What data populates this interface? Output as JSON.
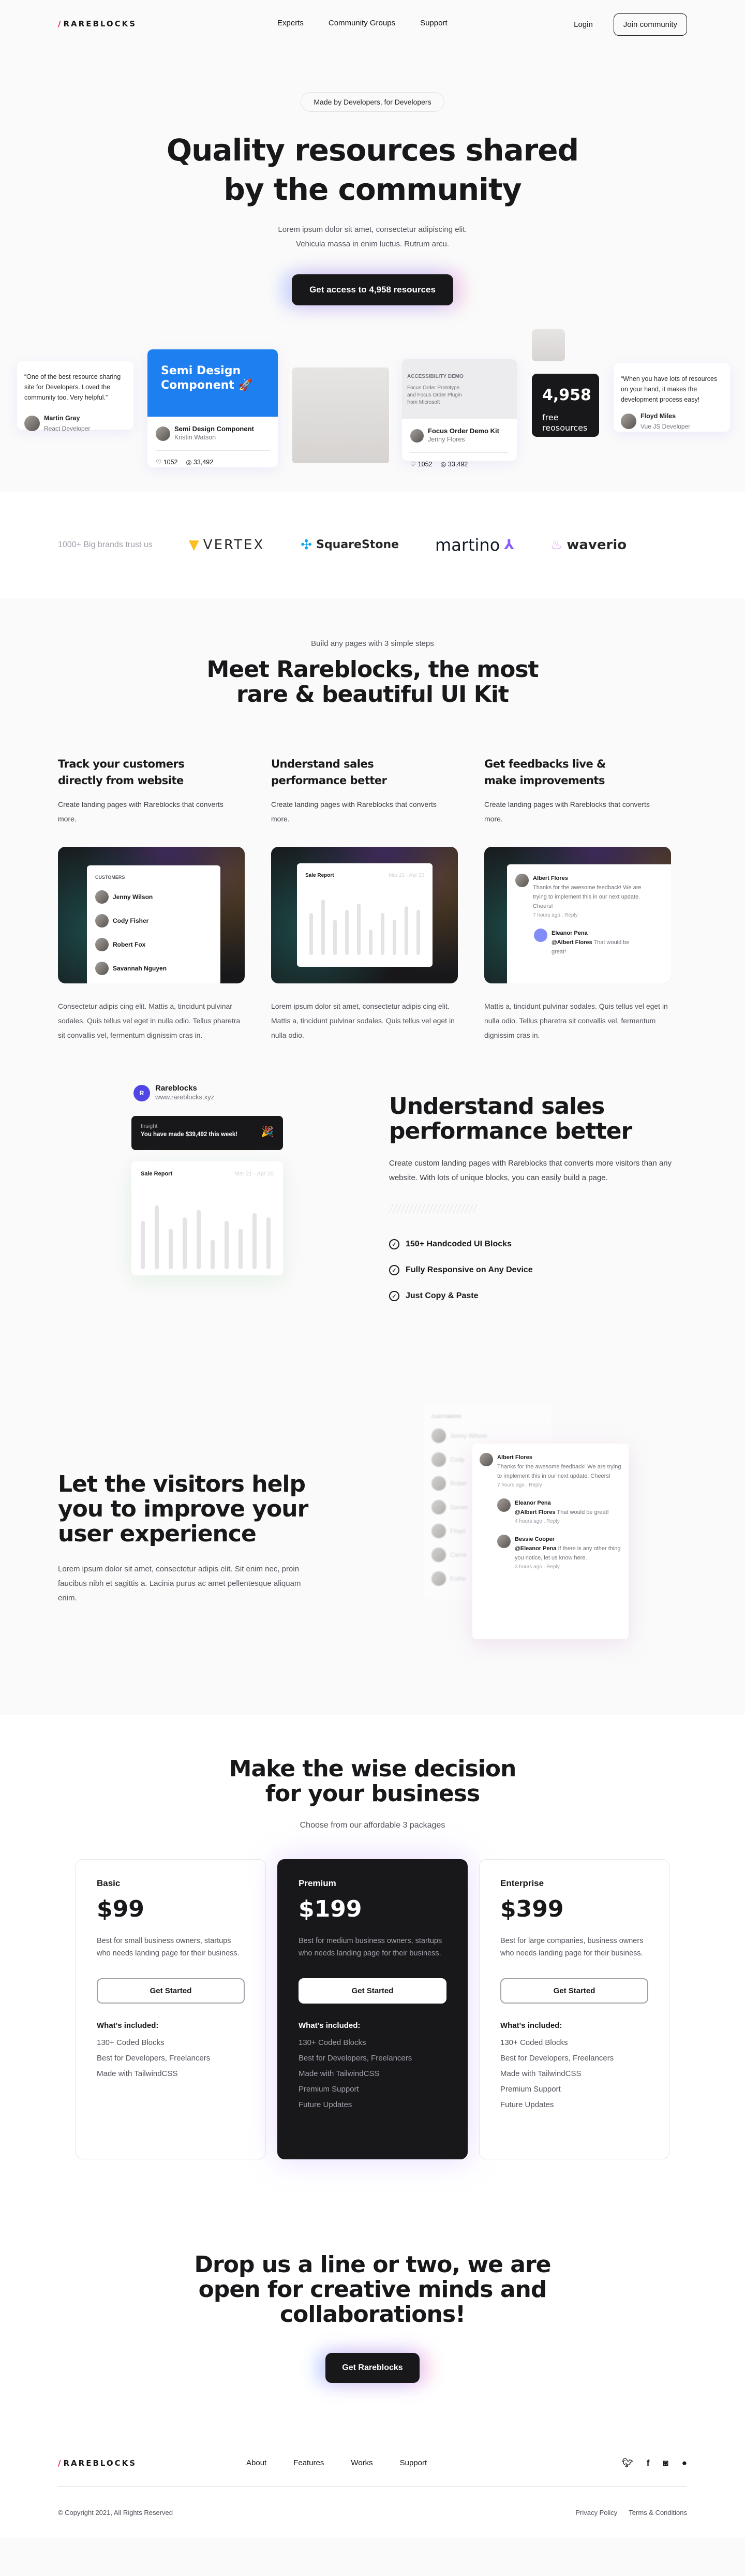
{
  "header": {
    "logo_slash": "/",
    "logo_text": "RAREBLOCKS",
    "nav": [
      "Experts",
      "Community Groups",
      "Support"
    ],
    "login": "Login",
    "join": "Join community"
  },
  "hero": {
    "pill": "Made by Developers, for Developers",
    "title_line1": "Quality resources shared",
    "title_line2": "by the community",
    "desc_line1": "Lorem ipsum dolor sit amet, consectetur adipiscing elit.",
    "desc_line2": "Vehicula massa in enim luctus. Rutrum arcu.",
    "cta": "Get access to 4,958 resources"
  },
  "showcase": {
    "testimonial1": {
      "quote": "“One of the best resource sharing site for Developers. Loved the community too. Very helpful.”",
      "name": "Martin Gray",
      "role": "React Developer"
    },
    "resource1": {
      "banner": "Semi Design Component 🚀",
      "title": "Semi Design Component",
      "author": "Kristin Watson",
      "likes": "1052",
      "views": "33,492"
    },
    "resource2": {
      "tag": "ACCESSIBILITY DEMO",
      "banner": "Focus Order Prototype and Focus Order Plugin from Microsoft",
      "title": "Focus Order Demo Kit",
      "author": "Jenny Flores",
      "likes": "1052",
      "views": "33,492"
    },
    "counter": {
      "number": "4,958",
      "label_line1": "free",
      "label_line2": "reosources"
    },
    "testimonial2": {
      "quote": "“When you have lots of resources on your hand, it makes the development process easy!",
      "name": "Floyd Miles",
      "role": "Vue JS Developer"
    }
  },
  "brands": {
    "label": "1000+ Big brands trust us",
    "items": [
      "VERTEX",
      "SquareStone",
      "martino",
      "waverio"
    ]
  },
  "meet": {
    "eyebrow": "Build any pages with 3 simple steps",
    "title_line1": "Meet Rareblocks, the most",
    "title_line2": "rare & beautiful UI Kit",
    "features": [
      {
        "title": "Track your customers directly from website",
        "desc": "Create landing pages with Rareblocks that converts more.",
        "body": "Consectetur adipis cing elit. Mattis a, tincidunt pulvinar sodales. Quis tellus vel eget in nulla odio. Tellus pharetra sit convallis vel, fermentum dignissim cras in."
      },
      {
        "title": "Understand sales performance better",
        "desc": "Create landing pages with Rareblocks that converts more.",
        "body": "Lorem ipsum dolor sit amet, consectetur adipis cing elit. Mattis a, tincidunt pulvinar sodales. Quis tellus vel eget in nulla odio."
      },
      {
        "title": "Get feedbacks live & make improvements",
        "desc": "Create landing pages with Rareblocks that converts more.",
        "body": "Mattis a, tincidunt pulvinar sodales. Quis tellus vel eget in nulla odio. Tellus pharetra sit convallis vel, fermentum dignissim cras in."
      }
    ],
    "customers_label": "CUSTOMERS",
    "customers": [
      "Jenny Wilson",
      "Cody Fisher",
      "Robert Fox",
      "Savannah Nguyen"
    ],
    "sale_report": {
      "title": "Sale Report",
      "range": "Mar 21 - Apr 20",
      "bars": [
        0.62,
        0.82,
        0.52,
        0.67,
        0.76,
        0.38,
        0.62,
        0.52,
        0.72,
        0.67
      ]
    },
    "comment": {
      "name": "Albert Flores",
      "text": "Thanks for the awesome feedback! We are trying to implement this in our next update. Cheers!",
      "meta": "7 hours ago  .  Reply",
      "reply_name": "Eleanor Pena",
      "reply_mention": "@Albert Flores",
      "reply_text": " That would be great!"
    }
  },
  "understand": {
    "brand": "Rareblocks",
    "brand_url": "www.rareblocks.xyz",
    "brand_initial": "R",
    "insight_label": "Insight",
    "insight_text": "You have made $39,492 this week!",
    "sale_title": "Sale Report",
    "sale_range": "Mar 21 - Apr 20",
    "title_line1": "Understand sales",
    "title_line2": "performance better",
    "desc": "Create custom landing pages with Rareblocks that converts more visitors than any website. With lots of unique blocks, you can easily build a page.",
    "checks": [
      "150+ Handcoded UI Blocks",
      "Fully Responsive on Any Device",
      "Just Copy & Paste"
    ]
  },
  "visitors": {
    "title_line1": "Let the visitors help",
    "title_line2": "you to improve your",
    "title_line3": "user experience",
    "desc": "Lorem ipsum dolor sit amet, consectetur adipis elit. Sit enim nec, proin faucibus nibh et sagittis a. Lacinia purus ac amet pellentesque aliquam enim.",
    "customers_label": "CUSTOMERS",
    "blurred_customers": [
      "Jenny Wilson",
      "Cody",
      "Rober",
      "Savan",
      "Floyd",
      "Came",
      "Esthe"
    ],
    "comments": [
      {
        "name": "Albert Flores",
        "mention": "",
        "text": "Thanks for the awesome feedback! We are trying to implement this in our next update. Cheers!",
        "meta": "7 hours ago  .  Reply"
      },
      {
        "name": "Eleanor Pena",
        "mention": "@Albert Flores",
        "text": " That would be great!",
        "meta": "4 hours ago  .  Reply"
      },
      {
        "name": "Bessie Cooper",
        "mention": "@Eleanor Pena",
        "text": " If there is any other thing you notice, let us know here.",
        "meta": "3 hours ago  .  Reply"
      }
    ]
  },
  "pricing": {
    "title_line1": "Make the wise decision",
    "title_line2": "for your business",
    "sub": "Choose from our affordable 3 packages",
    "included_label": "What's included:",
    "button": "Get Started",
    "plans": [
      {
        "name": "Basic",
        "price": "$99",
        "desc": "Best for small business owners, startups who needs landing page for their business.",
        "features": [
          "130+ Coded Blocks",
          "Best for Developers, Freelancers",
          "Made with TailwindCSS"
        ]
      },
      {
        "name": "Premium",
        "price": "$199",
        "desc": "Best for medium business owners, startups who needs landing page for their business.",
        "features": [
          "130+ Coded Blocks",
          "Best for Developers, Freelancers",
          "Made with TailwindCSS",
          "Premium Support",
          "Future Updates"
        ]
      },
      {
        "name": "Enterprise",
        "price": "$399",
        "desc": "Best for large companies, business owners who needs landing page for their business.",
        "features": [
          "130+ Coded Blocks",
          "Best for Developers, Freelancers",
          "Made with TailwindCSS",
          "Premium Support",
          "Future Updates"
        ]
      }
    ]
  },
  "cta": {
    "line1": "Drop us a line or two, we are",
    "line2": "open for creative minds and",
    "line3": "collaborations!",
    "button": "Get Rareblocks"
  },
  "footer": {
    "nav": [
      "About",
      "Features",
      "Works",
      "Support"
    ],
    "social": [
      "twitter",
      "facebook",
      "instagram",
      "github"
    ],
    "copyright": "© Copyright 2021, All Rights Reserved",
    "links": [
      "Privacy Policy",
      "Terms & Conditions"
    ]
  }
}
